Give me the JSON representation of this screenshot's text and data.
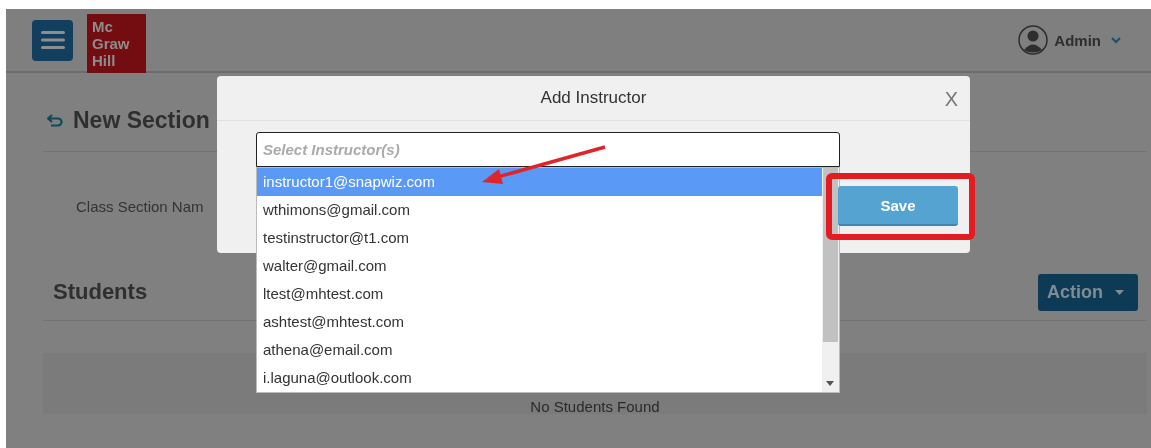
{
  "header": {
    "logo_lines": [
      "Mc",
      "Graw",
      "Hill"
    ],
    "user": "Admin"
  },
  "page": {
    "title": "New Section",
    "field_label": "Class Section Nam",
    "students_heading": "Students",
    "action_button": "Action",
    "empty_message": "No Students Found"
  },
  "modal": {
    "title": "Add Instructor",
    "close": "X",
    "select": {
      "placeholder": "Select Instructor(s)",
      "options": [
        {
          "label": "instructor1@snapwiz.com",
          "selected": true
        },
        {
          "label": "wthimons@gmail.com",
          "selected": false
        },
        {
          "label": "testinstructor@t1.com",
          "selected": false
        },
        {
          "label": "walter@gmail.com",
          "selected": false
        },
        {
          "label": "ltest@mhtest.com",
          "selected": false
        },
        {
          "label": "ashtest@mhtest.com",
          "selected": false
        },
        {
          "label": "athena@email.com",
          "selected": false
        },
        {
          "label": "i.laguna@outlook.com",
          "selected": false
        }
      ]
    },
    "save_button": "Save"
  }
}
